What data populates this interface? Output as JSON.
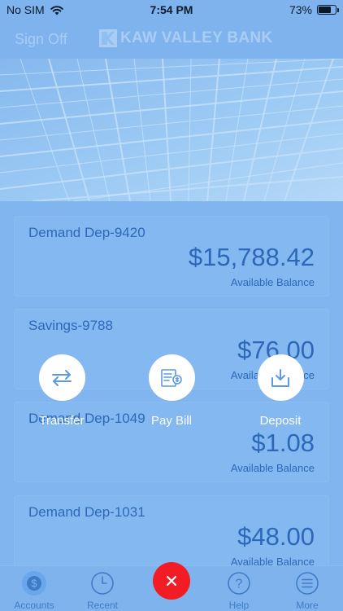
{
  "status_bar": {
    "carrier": "No SIM",
    "time": "7:54 PM",
    "battery_percent": "73%",
    "battery_level": 0.73
  },
  "header": {
    "sign_off": "Sign Off",
    "bank_name": "KAW VALLEY BANK"
  },
  "accounts": [
    {
      "name": "Demand Dep-9420",
      "amount": "$15,788.42",
      "label": "Available Balance"
    },
    {
      "name": "Savings-9788",
      "amount": "$76.00",
      "label": "Available Balance"
    },
    {
      "name": "Demand Dep-1049",
      "amount": "$1.08",
      "label": "Available Balance"
    },
    {
      "name": "Demand Dep-1031",
      "amount": "$48.00",
      "label": "Available Balance"
    }
  ],
  "actions": [
    {
      "label": "Transfer",
      "icon": "transfer-icon"
    },
    {
      "label": "Pay Bill",
      "icon": "bill-icon"
    },
    {
      "label": "Deposit",
      "icon": "deposit-icon"
    }
  ],
  "tabs": [
    {
      "label": "Accounts",
      "icon": "dollar-icon"
    },
    {
      "label": "Recent",
      "icon": "clock-icon"
    },
    {
      "label": "Help",
      "icon": "question-icon"
    },
    {
      "label": "More",
      "icon": "menu-icon"
    }
  ],
  "close_button": {
    "icon": "close-icon"
  },
  "colors": {
    "overlay": "#7fb3ee",
    "accent_text": "#2d68b8",
    "close": "#f21d24",
    "action_icon": "#5b9be6"
  }
}
